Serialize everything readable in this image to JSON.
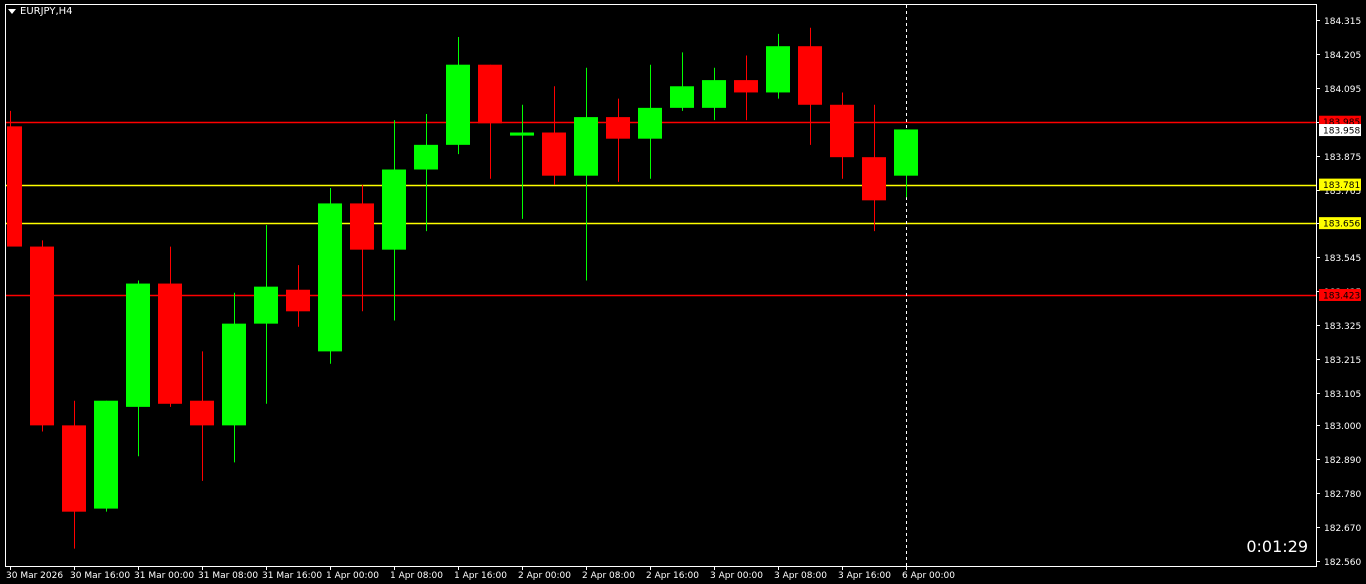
{
  "symbol": "EURJPY,H4",
  "timer": "0:01:29",
  "colors": {
    "background": "#000000",
    "bull": "#00ff00",
    "bear": "#ff0000",
    "frame": "#ffffff",
    "level_red": "#ff0000",
    "level_yellow": "#ffff00"
  },
  "chart_data": {
    "type": "candlestick",
    "ylim": [
      182.56,
      184.36
    ],
    "y_ticks": [
      "184.315",
      "184.205",
      "184.095",
      "183.985",
      "183.875",
      "183.765",
      "183.655",
      "183.545",
      "183.435",
      "183.325",
      "183.215",
      "183.105",
      "183.000",
      "182.890",
      "182.780",
      "182.670",
      "182.560"
    ],
    "x_labels": [
      {
        "index": 0,
        "label": "30 Mar 2026"
      },
      {
        "index": 2,
        "label": "30 Mar 16:00"
      },
      {
        "index": 4,
        "label": "31 Mar 00:00"
      },
      {
        "index": 6,
        "label": "31 Mar 08:00"
      },
      {
        "index": 8,
        "label": "31 Mar 16:00"
      },
      {
        "index": 10,
        "label": "1 Apr 00:00"
      },
      {
        "index": 12,
        "label": "1 Apr 08:00"
      },
      {
        "index": 14,
        "label": "1 Apr 16:00"
      },
      {
        "index": 16,
        "label": "2 Apr 00:00"
      },
      {
        "index": 18,
        "label": "2 Apr 08:00"
      },
      {
        "index": 20,
        "label": "2 Apr 16:00"
      },
      {
        "index": 22,
        "label": "3 Apr 00:00"
      },
      {
        "index": 24,
        "label": "3 Apr 08:00"
      },
      {
        "index": 26,
        "label": "3 Apr 16:00"
      },
      {
        "index": 28,
        "label": "6 Apr 00:00"
      }
    ],
    "candles": [
      {
        "o": 183.97,
        "h": 184.02,
        "l": 183.6,
        "c": 183.58
      },
      {
        "o": 183.58,
        "h": 183.6,
        "l": 182.98,
        "c": 183.0
      },
      {
        "o": 183.0,
        "h": 183.08,
        "l": 182.6,
        "c": 182.72
      },
      {
        "o": 182.73,
        "h": 183.08,
        "l": 182.72,
        "c": 183.08
      },
      {
        "o": 183.06,
        "h": 183.47,
        "l": 182.9,
        "c": 183.46
      },
      {
        "o": 183.46,
        "h": 183.58,
        "l": 183.06,
        "c": 183.07
      },
      {
        "o": 183.08,
        "h": 183.24,
        "l": 182.82,
        "c": 183.0
      },
      {
        "o": 183.0,
        "h": 183.43,
        "l": 182.88,
        "c": 183.33
      },
      {
        "o": 183.33,
        "h": 183.65,
        "l": 183.07,
        "c": 183.45
      },
      {
        "o": 183.44,
        "h": 183.52,
        "l": 183.32,
        "c": 183.37
      },
      {
        "o": 183.24,
        "h": 183.77,
        "l": 183.2,
        "c": 183.72
      },
      {
        "o": 183.72,
        "h": 183.78,
        "l": 183.37,
        "c": 183.57
      },
      {
        "o": 183.57,
        "h": 183.99,
        "l": 183.34,
        "c": 183.83
      },
      {
        "o": 183.83,
        "h": 184.01,
        "l": 183.63,
        "c": 183.91
      },
      {
        "o": 183.91,
        "h": 184.26,
        "l": 183.88,
        "c": 184.17
      },
      {
        "o": 184.17,
        "h": 184.17,
        "l": 183.8,
        "c": 183.98
      },
      {
        "o": 183.94,
        "h": 184.04,
        "l": 183.67,
        "c": 183.95
      },
      {
        "o": 183.95,
        "h": 184.1,
        "l": 183.78,
        "c": 183.81
      },
      {
        "o": 183.81,
        "h": 184.16,
        "l": 183.47,
        "c": 184.0
      },
      {
        "o": 184.0,
        "h": 184.06,
        "l": 183.79,
        "c": 183.93
      },
      {
        "o": 183.93,
        "h": 184.17,
        "l": 183.8,
        "c": 184.03
      },
      {
        "o": 184.03,
        "h": 184.21,
        "l": 184.02,
        "c": 184.1
      },
      {
        "o": 184.03,
        "h": 184.16,
        "l": 183.99,
        "c": 184.12
      },
      {
        "o": 184.12,
        "h": 184.2,
        "l": 183.99,
        "c": 184.08
      },
      {
        "o": 184.08,
        "h": 184.27,
        "l": 184.06,
        "c": 184.23
      },
      {
        "o": 184.23,
        "h": 184.29,
        "l": 183.91,
        "c": 184.04
      },
      {
        "o": 184.04,
        "h": 184.08,
        "l": 183.8,
        "c": 183.87
      },
      {
        "o": 183.87,
        "h": 184.04,
        "l": 183.63,
        "c": 183.73
      },
      {
        "o": 183.81,
        "h": 183.96,
        "l": 183.74,
        "c": 183.96
      }
    ],
    "levels": [
      {
        "price": 183.985,
        "label": "183.985",
        "color": "#ff0000"
      },
      {
        "price": 183.781,
        "label": "183.781",
        "color": "#ffff00"
      },
      {
        "price": 183.656,
        "label": "183.656",
        "color": "#ffff00"
      },
      {
        "price": 183.423,
        "label": "183.423",
        "color": "#ff0000"
      }
    ],
    "current_price": {
      "value": 183.958,
      "label": "183.958"
    },
    "cursor_index": 28
  }
}
